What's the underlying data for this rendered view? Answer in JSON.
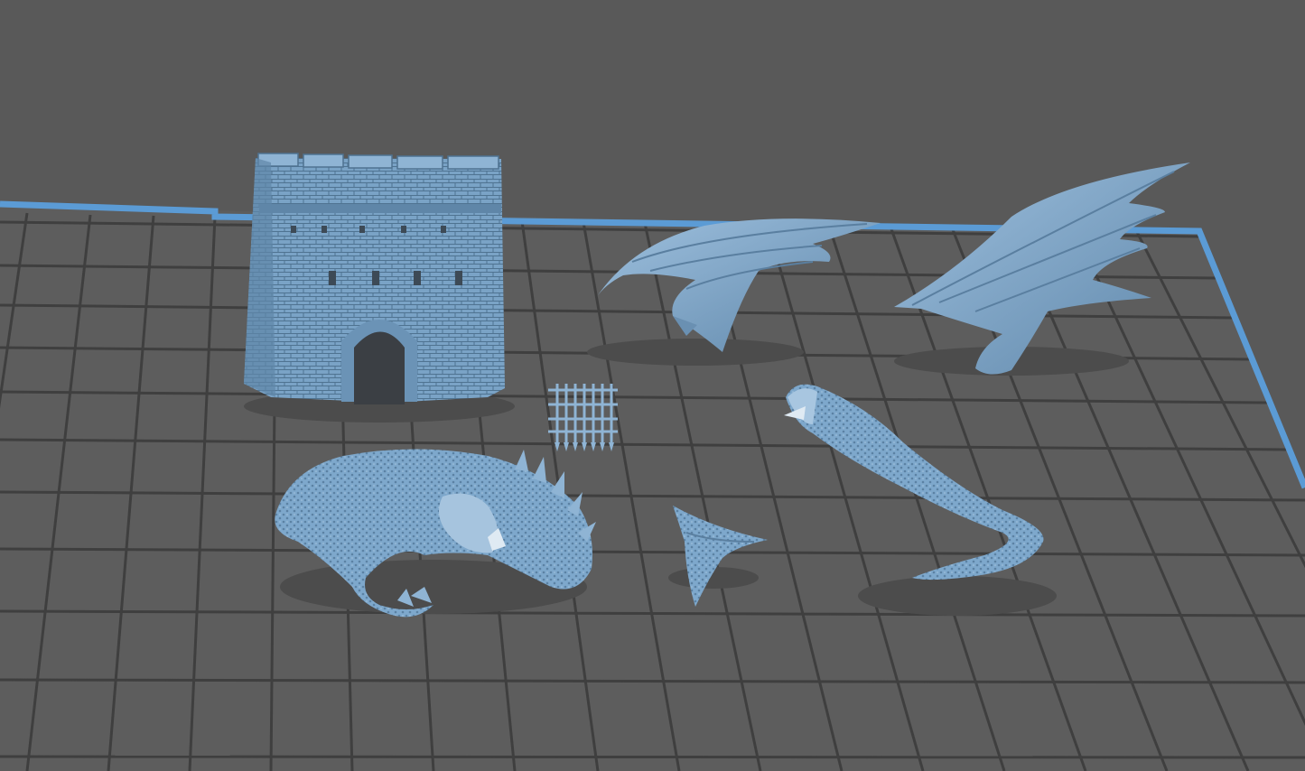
{
  "scene": {
    "background_color": "#595959",
    "plate_color": "#5e5e5e",
    "grid_line_color": "#3d3d3d",
    "bed_edge_color": "#5b9bd5",
    "model_color": "#7aa3c6",
    "model_shadow_color": "#4e4e4e",
    "view": "perspective",
    "objects": [
      {
        "name": "castle-gatehouse",
        "label": "gatehouse"
      },
      {
        "name": "portcullis",
        "label": "portcullis"
      },
      {
        "name": "dragon-wing-left",
        "label": "wing"
      },
      {
        "name": "dragon-wing-right",
        "label": "wing"
      },
      {
        "name": "dragon-body",
        "label": "body"
      },
      {
        "name": "dragon-tail",
        "label": "tail"
      },
      {
        "name": "dragon-head-part",
        "label": "part"
      }
    ]
  }
}
